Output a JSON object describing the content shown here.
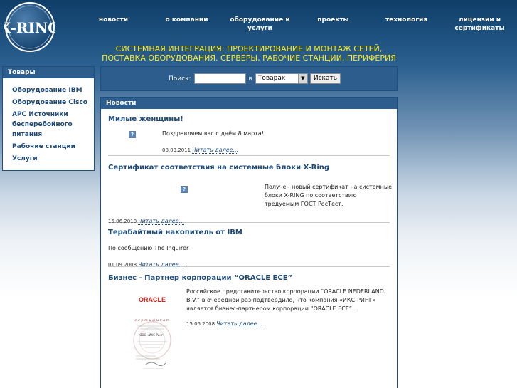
{
  "logo": {
    "text": "X-RING"
  },
  "nav": [
    "новости",
    "о компании",
    "оборудование и услуги",
    "проекты",
    "технология",
    "лицензии и сертификаты"
  ],
  "tagline": "Системная интеграция: проектирование и монтаж сетей, поставка оборудования. Серверы, рабочие станции, периферия",
  "sidebar": {
    "title": "Товары",
    "items": [
      "Оборудование IBM",
      "Оборудование Cisco",
      "APC Источники бесперебойного питания",
      "Рабочие станции",
      "Услуги"
    ]
  },
  "search": {
    "label": "Поиск:",
    "value": "",
    "in_label": "в",
    "selected": "Товарах",
    "button": "Искать"
  },
  "news": {
    "title": "Новости",
    "more_label": "Читать далее...",
    "articles": [
      {
        "title": "Милые женщины!",
        "text": "Поздравляем вас с днём 8 марта!",
        "date": "08.03.2011"
      },
      {
        "title": "Сертификат соответствия на системные блоки X-Ring",
        "text": "Получен новый сертификат на системные блоки X-RING по соответствию тредуемым ГОСТ РосТест.",
        "date": "15.06.2010"
      },
      {
        "title": "Терабайтный накопитель от IBM",
        "text": "По сообщению The Inquirer",
        "date": "01.09.2008"
      },
      {
        "title": "Бизнес - Партнер корпорации “ORACLE ECE”",
        "text": "Российское представительство корпорации “ORACLE NEDERLAND B.V.” в очередной раз подтвердило, что компания «ИКС-РИНГ» является бизнес-партнером корпорации “ORACLE ECE”.",
        "date": "15.05.2008"
      }
    ]
  },
  "certificate": {
    "brand": "ORACLE",
    "heading": "с е р т и ф и к а т",
    "company": "ООО «ИКС-Ринг»"
  }
}
